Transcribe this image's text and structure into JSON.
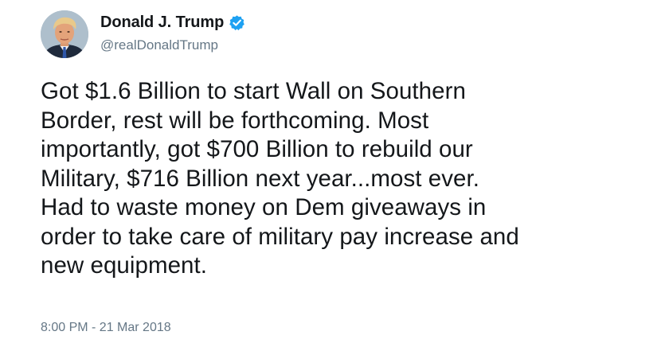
{
  "author": {
    "display_name": "Donald J. Trump",
    "handle": "@realDonaldTrump",
    "verified": true,
    "avatar_icon": "profile-photo",
    "verified_icon": "verified-badge-icon",
    "verified_color": "#1da1f2"
  },
  "tweet": {
    "text": "Got $1.6 Billion to start Wall on Southern\nBorder, rest will be forthcoming. Most\nimportantly, got $700 Billion to rebuild our\nMilitary, $716 Billion next year...most ever.\nHad to waste money on Dem giveaways in\norder to take care of military pay increase and\nnew equipment.",
    "timestamp": "8:00 PM - 21 Mar 2018"
  },
  "colors": {
    "text": "#14171a",
    "secondary": "#657786",
    "background": "#ffffff"
  }
}
